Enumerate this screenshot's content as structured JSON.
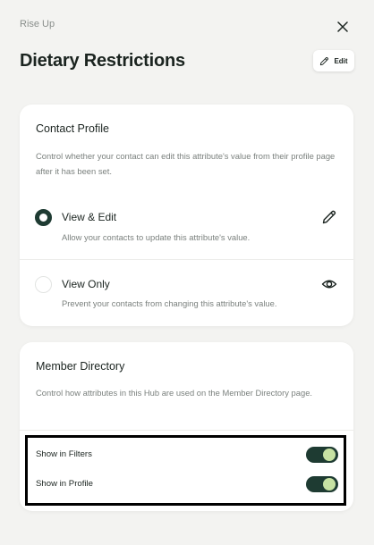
{
  "header": {
    "app_name": "Rise Up",
    "title": "Dietary Restrictions",
    "edit_label": "Edit"
  },
  "contact_profile": {
    "title": "Contact Profile",
    "description": "Control whether your contact can edit this attribute's value from their profile page after it has been set.",
    "options": [
      {
        "label": "View & Edit",
        "description": "Allow your contacts to update this attribute's value.",
        "selected": true,
        "icon": "pencil-icon"
      },
      {
        "label": "View Only",
        "description": "Prevent your contacts from changing this attribute's value.",
        "selected": false,
        "icon": "eye-icon"
      }
    ]
  },
  "member_directory": {
    "title": "Member Directory",
    "description": "Control how attributes in this Hub are used on the Member Directory page.",
    "toggles": [
      {
        "label": "Show in Filters",
        "on": true
      },
      {
        "label": "Show in Profile",
        "on": true
      }
    ]
  },
  "colors": {
    "accent": "#1e3b32",
    "toggle_knob": "#c7e2a3",
    "background": "#f3f3f1"
  }
}
